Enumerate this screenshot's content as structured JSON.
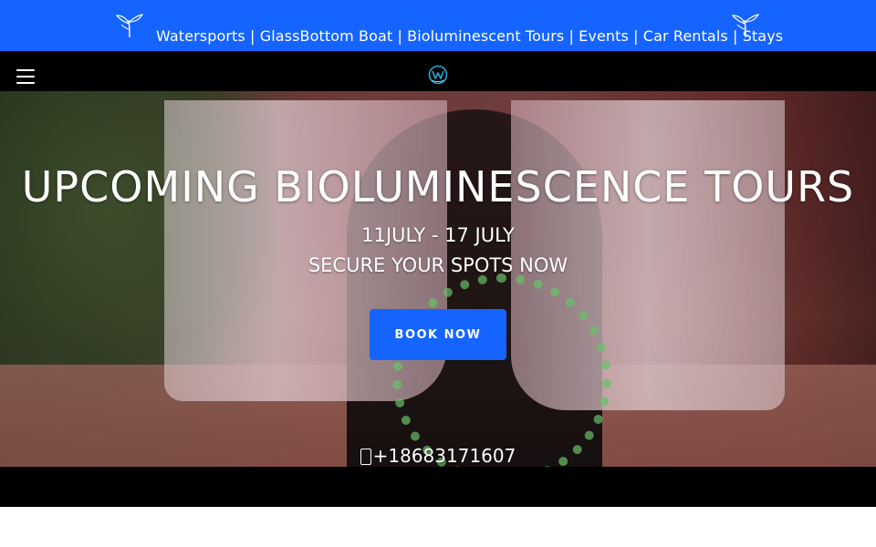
{
  "topbar": {
    "nav_text": "Watersports | GlassBottom Boat | Bioluminescent Tours | Events | Car Rentals | Stays",
    "left_icon": "sprout-icon",
    "right_icon": "sprout-icon"
  },
  "header": {
    "menu_icon": "hamburger-menu-icon",
    "logo_icon": "w-logo-icon"
  },
  "hero": {
    "title": "UPCOMING BIOLUMINESCENCE TOURS",
    "dates": "11JULY - 17 JULY",
    "subtitle": "SECURE YOUR SPOTS NOW",
    "cta_label": "BOOK NOW",
    "phone": "+18683171607"
  },
  "colors": {
    "accent": "#1564ff",
    "header_bg": "#000000",
    "text": "#ffffff"
  }
}
